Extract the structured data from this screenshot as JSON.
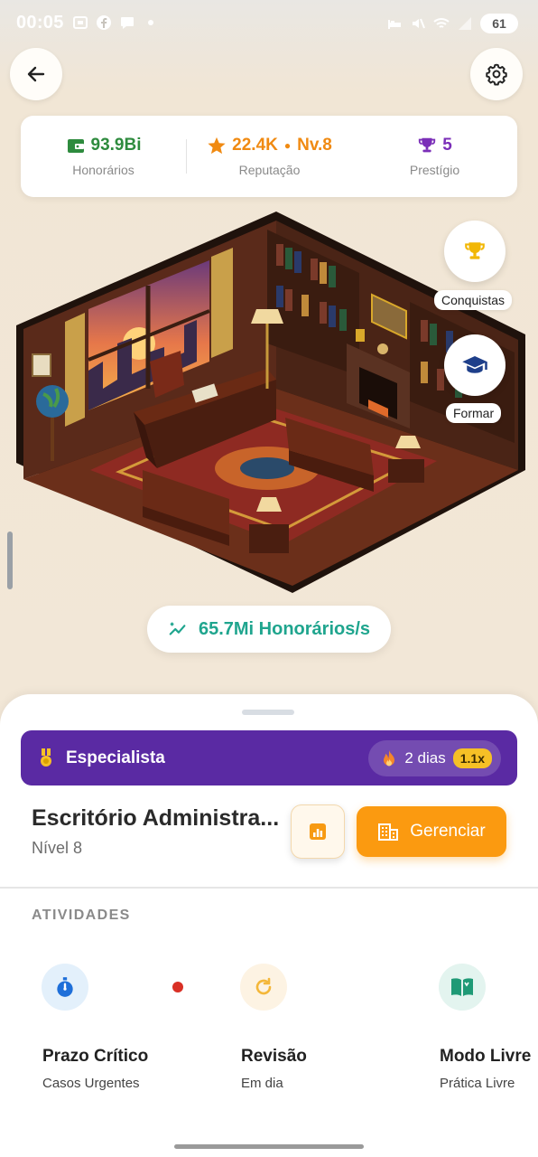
{
  "status_bar": {
    "time": "00:05",
    "battery": "61"
  },
  "stats": {
    "fees_value": "93.9Bi",
    "fees_label": "Honorários",
    "reputation_value": "22.4K",
    "reputation_level": "Nv.8",
    "reputation_label": "Reputação",
    "prestige_value": "5",
    "prestige_label": "Prestígio"
  },
  "side_actions": {
    "achievements_label": "Conquistas",
    "train_label": "Formar"
  },
  "rate": {
    "text": "65.7Mi Honorários/s"
  },
  "banner": {
    "title": "Especialista",
    "streak": "2 dias",
    "multiplier": "1.1x"
  },
  "office": {
    "name": "Escritório Administra...",
    "level": "Nível 8"
  },
  "manage_label": "Gerenciar",
  "activities": {
    "section_title": "ATIVIDADES",
    "items": [
      {
        "title": "Prazo Crítico",
        "subtitle": "Casos Urgentes",
        "icon": "stopwatch-icon"
      },
      {
        "title": "Revisão",
        "subtitle": "Em dia",
        "icon": "refresh-icon"
      },
      {
        "title": "Modo Livre",
        "subtitle": "Prática Livre",
        "icon": "open-book-icon"
      }
    ]
  },
  "colors": {
    "accent_orange": "#fb9a10",
    "banner_purple": "#5a2aa3",
    "rate_teal": "#1fa58e",
    "fees_green": "#2e8b3e",
    "prestige_purple": "#7b2fb8"
  }
}
